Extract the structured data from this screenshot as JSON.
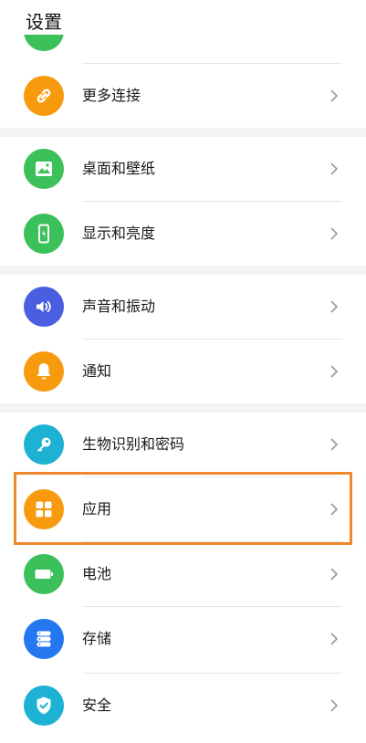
{
  "header": {
    "title": "设置"
  },
  "colors": {
    "green": "#3cc05a",
    "orange": "#f79a0e",
    "blue_purple": "#4a5fe0",
    "teal": "#1db2d3",
    "blue": "#2477ef",
    "highlight": "#f0882e",
    "separator": "#f1f3f5"
  },
  "rows": [
    {
      "label": "更多连接",
      "icon": "link-icon"
    },
    {
      "label": "桌面和壁纸",
      "icon": "picture-icon"
    },
    {
      "label": "显示和亮度",
      "icon": "phone-brightness-icon"
    },
    {
      "label": "声音和振动",
      "icon": "speaker-icon"
    },
    {
      "label": "通知",
      "icon": "bell-icon"
    },
    {
      "label": "生物识别和密码",
      "icon": "key-icon"
    },
    {
      "label": "应用",
      "icon": "apps-grid-icon"
    },
    {
      "label": "电池",
      "icon": "battery-icon"
    },
    {
      "label": "存储",
      "icon": "storage-icon"
    },
    {
      "label": "安全",
      "icon": "shield-check-icon"
    }
  ]
}
